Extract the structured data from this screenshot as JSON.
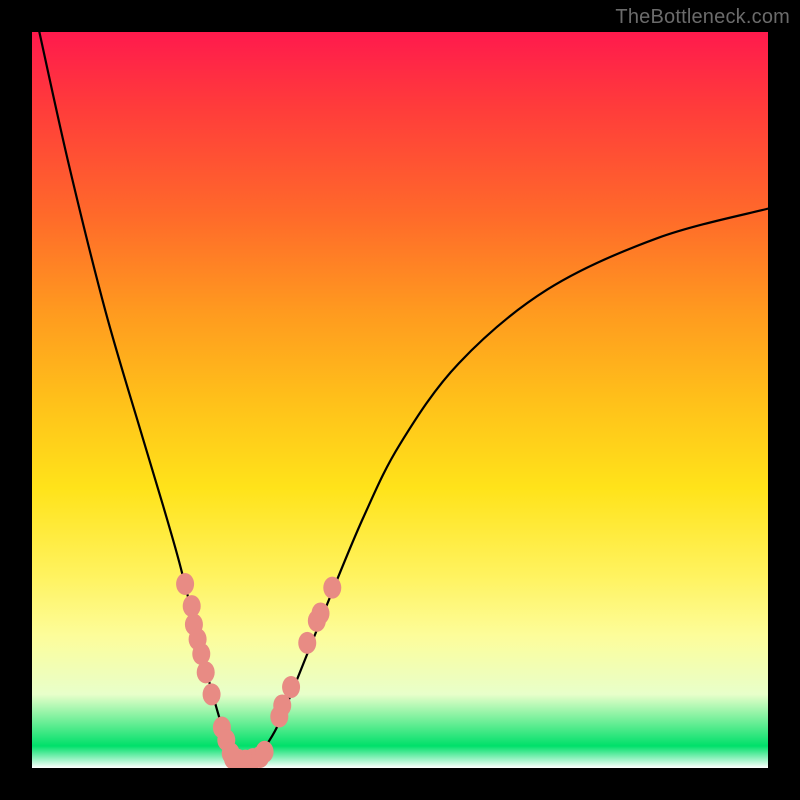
{
  "watermark": "TheBottleneck.com",
  "chart_data": {
    "type": "line",
    "title": "",
    "xlabel": "",
    "ylabel": "",
    "xlim": [
      0,
      100
    ],
    "ylim": [
      0,
      100
    ],
    "series": [
      {
        "name": "curve",
        "x": [
          1,
          5,
          10,
          15,
          18,
          20,
          22,
          24,
          26,
          27,
          28,
          30,
          33,
          36,
          40,
          45,
          50,
          58,
          70,
          85,
          100
        ],
        "values": [
          100,
          82,
          62,
          45,
          35,
          28,
          20,
          12,
          5,
          2,
          1,
          1,
          5,
          12,
          22,
          34,
          44,
          55,
          65,
          72,
          76
        ]
      }
    ],
    "markers": {
      "name": "highlight-dots",
      "color": "#e88b84",
      "points": [
        {
          "x": 20.8,
          "y": 25.0
        },
        {
          "x": 21.7,
          "y": 22.0
        },
        {
          "x": 22.0,
          "y": 19.5
        },
        {
          "x": 22.5,
          "y": 17.5
        },
        {
          "x": 23.0,
          "y": 15.5
        },
        {
          "x": 23.6,
          "y": 13.0
        },
        {
          "x": 24.4,
          "y": 10.0
        },
        {
          "x": 25.8,
          "y": 5.5
        },
        {
          "x": 26.4,
          "y": 3.8
        },
        {
          "x": 27.0,
          "y": 2.0
        },
        {
          "x": 27.3,
          "y": 1.3
        },
        {
          "x": 28.0,
          "y": 1.1
        },
        {
          "x": 29.0,
          "y": 1.0
        },
        {
          "x": 30.0,
          "y": 1.2
        },
        {
          "x": 31.0,
          "y": 1.5
        },
        {
          "x": 31.6,
          "y": 2.2
        },
        {
          "x": 33.6,
          "y": 7.0
        },
        {
          "x": 34.0,
          "y": 8.5
        },
        {
          "x": 35.2,
          "y": 11.0
        },
        {
          "x": 37.4,
          "y": 17.0
        },
        {
          "x": 38.7,
          "y": 20.0
        },
        {
          "x": 39.2,
          "y": 21.0
        },
        {
          "x": 40.8,
          "y": 24.5
        }
      ]
    }
  }
}
